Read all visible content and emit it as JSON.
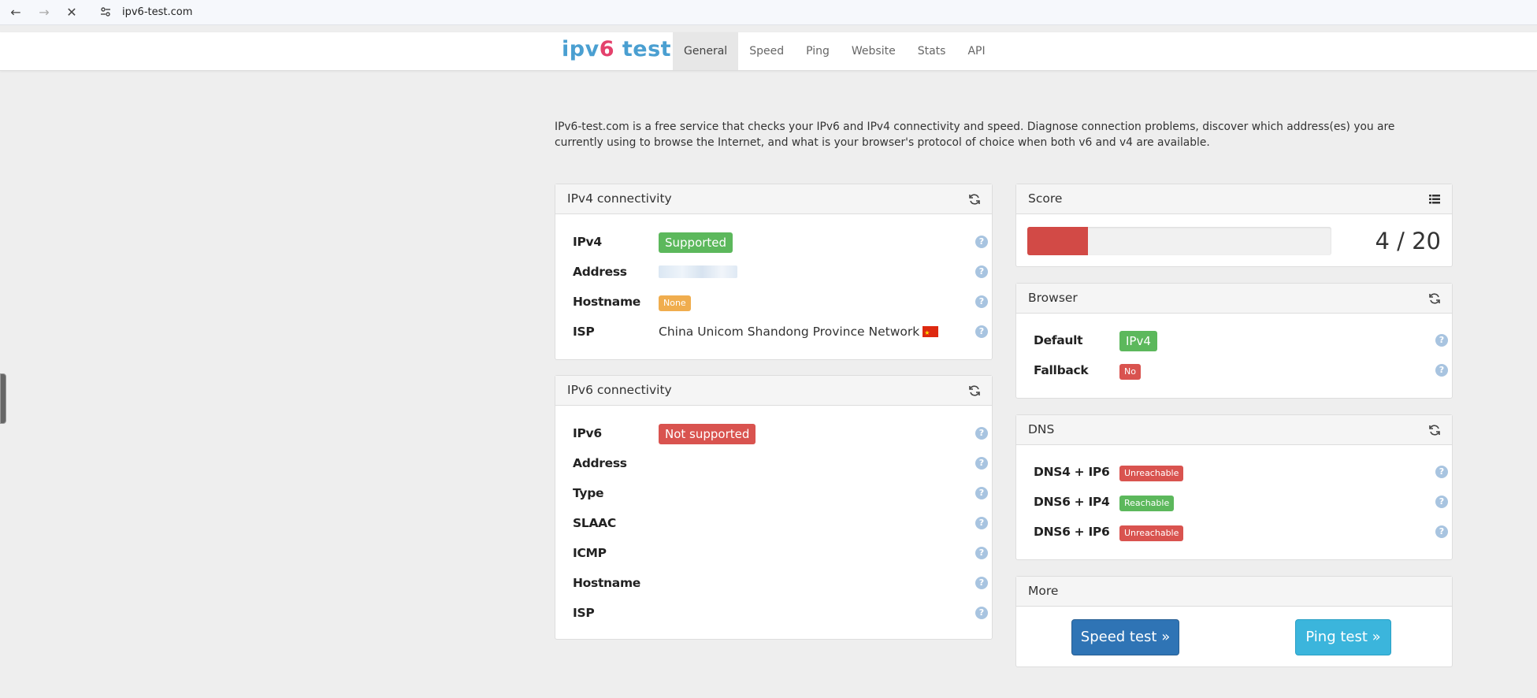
{
  "browser": {
    "url": "ipv6-test.com"
  },
  "site": {
    "logo": {
      "part1": "ipv",
      "part2": "6",
      "part3": " test"
    },
    "tabs": [
      "General",
      "Speed",
      "Ping",
      "Website",
      "Stats",
      "API"
    ],
    "active_tab": "General"
  },
  "intro": "IPv6-test.com is a free service that checks your IPv6 and IPv4 connectivity and speed. Diagnose connection problems, discover which address(es) you are currently using to browse the Internet, and what is your browser's protocol of choice when both v6 and v4 are available.",
  "ipv4": {
    "title": "IPv4 connectivity",
    "rows": {
      "ipv4_label": "IPv4",
      "ipv4_value": "Supported",
      "address_label": "Address",
      "hostname_label": "Hostname",
      "hostname_value": "None",
      "isp_label": "ISP",
      "isp_value": "China Unicom Shandong Province Network"
    }
  },
  "ipv6": {
    "title": "IPv6 connectivity",
    "rows": {
      "ipv6_label": "IPv6",
      "ipv6_value": "Not supported",
      "address_label": "Address",
      "type_label": "Type",
      "slaac_label": "SLAAC",
      "icmp_label": "ICMP",
      "hostname_label": "Hostname",
      "isp_label": "ISP"
    }
  },
  "score": {
    "title": "Score",
    "value": "4 / 20",
    "fraction": 0.2
  },
  "browser_panel": {
    "title": "Browser",
    "default_label": "Default",
    "default_value": "IPv4",
    "fallback_label": "Fallback",
    "fallback_value": "No"
  },
  "dns": {
    "title": "DNS",
    "row1_label": "DNS4 + IP6",
    "row1_value": "Unreachable",
    "row2_label": "DNS6 + IP4",
    "row2_value": "Reachable",
    "row3_label": "DNS6 + IP6",
    "row3_value": "Unreachable"
  },
  "more": {
    "title": "More",
    "speed_button": "Speed test »",
    "ping_button": "Ping test »"
  },
  "colors": {
    "supported": "#5cb85c",
    "unsupported": "#d9534f",
    "none": "#f0ad4e",
    "score_fill": "#d24a46"
  }
}
